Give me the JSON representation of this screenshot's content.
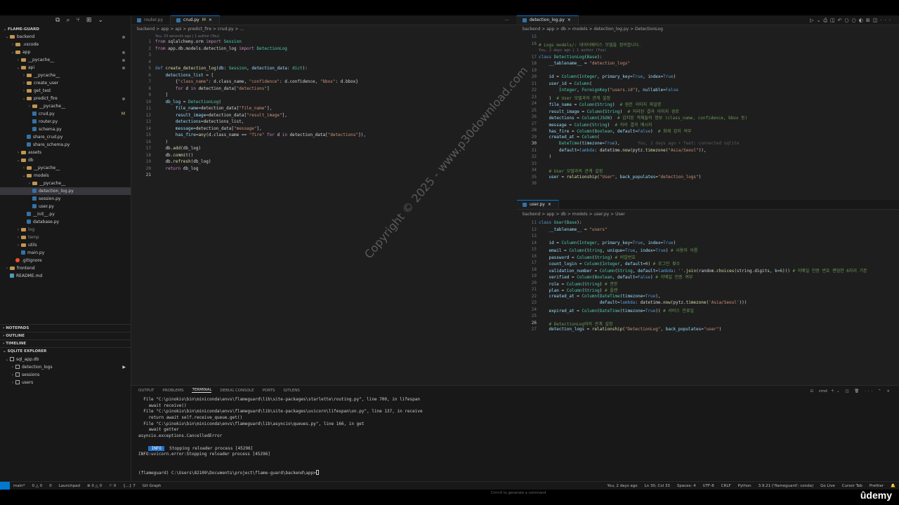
{
  "sidebar": {
    "root": "FLAME-GUARD",
    "tree": [
      {
        "label": "backend",
        "type": "folder",
        "depth": 0,
        "open": true,
        "dot": true
      },
      {
        "label": ".vscode",
        "type": "folder",
        "depth": 1,
        "open": false
      },
      {
        "label": "app",
        "type": "folder",
        "depth": 1,
        "open": true,
        "dot": true
      },
      {
        "label": "__pycache__",
        "type": "folder",
        "depth": 2,
        "open": false,
        "dot": true
      },
      {
        "label": "api",
        "type": "folder",
        "depth": 2,
        "open": true,
        "dot": true
      },
      {
        "label": "__pycache__",
        "type": "folder",
        "depth": 3,
        "open": false
      },
      {
        "label": "create_user",
        "type": "folder",
        "depth": 3,
        "open": false
      },
      {
        "label": "get_test",
        "type": "folder",
        "depth": 3,
        "open": false
      },
      {
        "label": "predict_fire",
        "type": "folder",
        "depth": 3,
        "open": true,
        "dot": true
      },
      {
        "label": "__pycache__",
        "type": "folder",
        "depth": 4,
        "open": false
      },
      {
        "label": "crud.py",
        "type": "py",
        "depth": 4,
        "mod": "M"
      },
      {
        "label": "router.py",
        "type": "py",
        "depth": 4
      },
      {
        "label": "schema.py",
        "type": "py",
        "depth": 4
      },
      {
        "label": "share_crud.py",
        "type": "py",
        "depth": 3
      },
      {
        "label": "share_schema.py",
        "type": "py",
        "depth": 3
      },
      {
        "label": "assets",
        "type": "folder",
        "depth": 2,
        "open": false
      },
      {
        "label": "db",
        "type": "folder",
        "depth": 2,
        "open": true
      },
      {
        "label": "__pycache__",
        "type": "folder",
        "depth": 3,
        "open": false
      },
      {
        "label": "models",
        "type": "folder",
        "depth": 3,
        "open": true
      },
      {
        "label": "__pycache__",
        "type": "folder",
        "depth": 4,
        "open": false
      },
      {
        "label": "detection_log.py",
        "type": "py",
        "depth": 4,
        "selected": true
      },
      {
        "label": "session.py",
        "type": "py",
        "depth": 4
      },
      {
        "label": "user.py",
        "type": "py",
        "depth": 4
      },
      {
        "label": "__init__.py",
        "type": "py",
        "depth": 3
      },
      {
        "label": "database.py",
        "type": "py",
        "depth": 3
      },
      {
        "label": "log",
        "type": "folder",
        "depth": 2,
        "open": false
      },
      {
        "label": "temp",
        "type": "folder",
        "depth": 2,
        "open": false
      },
      {
        "label": "utils",
        "type": "folder",
        "depth": 2,
        "open": false
      },
      {
        "label": "main.py",
        "type": "py",
        "depth": 2
      },
      {
        "label": ".gitignore",
        "type": "git",
        "depth": 1
      },
      {
        "label": "frontend",
        "type": "folder",
        "depth": 0,
        "open": false
      },
      {
        "label": "README.md",
        "type": "md",
        "depth": 0
      }
    ],
    "sections": [
      "NOTEPADS",
      "OUTLINE",
      "TIMELINE",
      "SQLITE EXPLORER"
    ],
    "sqlite": [
      {
        "label": "sql_app.db",
        "depth": 0
      },
      {
        "label": "detection_logs",
        "depth": 1
      },
      {
        "label": "sessions",
        "depth": 1
      },
      {
        "label": "users",
        "depth": 1
      }
    ]
  },
  "editor_left": {
    "tabs": [
      {
        "label": "router.py",
        "active": false
      },
      {
        "label": "crud.py",
        "active": true,
        "mod": "M"
      }
    ],
    "breadcrumb": "backend > app > api > predict_fire > crud.py > ...",
    "blame": "You, 33 seconds ago | 1 author (You)"
  },
  "editor_right_top": {
    "tab": "detection_log.py",
    "breadcrumb": "backend > app > db > models > detection_log.py > DetectionLog",
    "blame": "You, 2 days ago | 1 author (You)",
    "inline_blame": "You, 2 days ago • feat: connected sqlite"
  },
  "editor_right_bottom": {
    "tab": "user.py",
    "breadcrumb": "backend > app > db > models > user.py > User"
  },
  "panel": {
    "tabs": [
      "OUTPUT",
      "PROBLEMS",
      "TERMINAL",
      "DEBUG CONSOLE",
      "PORTS",
      "GITLENS"
    ],
    "active_tab": "TERMINAL",
    "shell": "cmd",
    "lines": [
      "  File \"C:\\pinokio\\bin\\miniconda\\envs\\flameguard\\lib\\site-packages\\starlette\\routing.py\", line 700, in lifespan",
      "    await receive()",
      "  File \"C:\\pinokio\\bin\\miniconda\\envs\\flameguard\\lib\\site-packages\\uvicorn\\lifespan\\on.py\", line 137, in receive",
      "    return await self.receive_queue.get()",
      "  File \"C:\\pinokio\\bin\\miniconda\\envs\\flameguard\\lib\\asyncio\\queues.py\", line 166, in get",
      "    await getter",
      "asyncio.exceptions.CancelledError",
      "",
      "",
      "INFO:uvicorn.error:Stopping reloader process [45296]",
      "",
      "",
      "(flameguard) C:\\Users\\82109\\Documents\\project\\flame-guard\\backend\\app>"
    ],
    "info_label": "INFO",
    "info_text": "  Stopping reloader process [45296]",
    "hint": "Ctrl+K to generate a command"
  },
  "status": {
    "left": [
      "main*",
      "0 △ 0",
      "0",
      "Launchpad",
      "⊗ 0 △ 0",
      "⚐ 0",
      "{...} 7",
      "Git Graph"
    ],
    "right": [
      "You, 2 days ago",
      "Ln 30, Col 33",
      "Spaces: 4",
      "UTF-8",
      "CRLF",
      "Python",
      "3.9.21 ('flameguard': conda)",
      "Go Live",
      "Cursor Tab",
      "Prettier"
    ]
  },
  "watermark": "Copyright © 2025 - www.p30download.com",
  "brand": "ûdemy"
}
